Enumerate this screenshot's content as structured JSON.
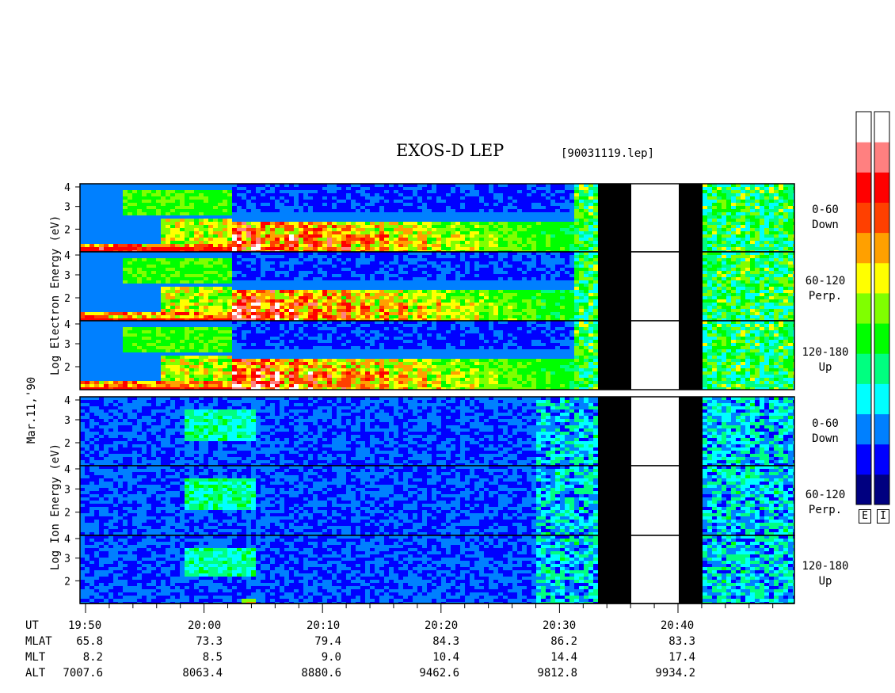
{
  "title": "EXOS-D LEP",
  "file_id": "[90031119.lep]",
  "date_label": "Mar.11,'90",
  "electron_axis_label": "Log  Electron  Energy (eV)",
  "ion_axis_label": "Log  Ion  Energy (eV)",
  "colorbar_labels": [
    "E",
    "I"
  ],
  "pitch_angle_labels": [
    {
      "range": "0-60",
      "dir": "Down"
    },
    {
      "range": "60-120",
      "dir": "Perp."
    },
    {
      "range": "120-180",
      "dir": "Up"
    },
    {
      "range": "0-60",
      "dir": "Down"
    },
    {
      "range": "60-120",
      "dir": "Perp."
    },
    {
      "range": "120-180",
      "dir": "Up"
    }
  ],
  "ephemeris": {
    "rows": [
      "UT",
      "MLAT",
      "MLT",
      "ALT"
    ],
    "columns": [
      {
        "UT": "19:50",
        "MLAT": "65.8",
        "MLT": "8.2",
        "ALT": "7007.6"
      },
      {
        "UT": "20:00",
        "MLAT": "73.3",
        "MLT": "8.5",
        "ALT": "8063.4"
      },
      {
        "UT": "20:10",
        "MLAT": "79.4",
        "MLT": "9.0",
        "ALT": "8880.6"
      },
      {
        "UT": "20:20",
        "MLAT": "84.3",
        "MLT": "10.4",
        "ALT": "9462.6"
      },
      {
        "UT": "20:30",
        "MLAT": "86.2",
        "MLT": "14.4",
        "ALT": "9812.8"
      },
      {
        "UT": "20:40",
        "MLAT": "83.3",
        "MLT": "17.4",
        "ALT": "9934.2"
      }
    ]
  },
  "chart_data": {
    "type": "heatmap",
    "title": "EXOS-D LEP",
    "xlabel": "UT",
    "x_ticks": [
      "19:50",
      "20:00",
      "20:10",
      "20:20",
      "20:30",
      "20:40"
    ],
    "x_range_minutes": [
      0,
      59
    ],
    "ylabel_electron": "Log Electron Energy (eV)",
    "ylabel_ion": "Log Ion Energy (eV)",
    "y_ticks": [
      "2",
      "3",
      "4"
    ],
    "ylim": [
      1,
      4
    ],
    "panels": [
      {
        "species": "Electron",
        "pitch_angle": "0-60",
        "direction": "Down"
      },
      {
        "species": "Electron",
        "pitch_angle": "60-120",
        "direction": "Perp."
      },
      {
        "species": "Electron",
        "pitch_angle": "120-180",
        "direction": "Up"
      },
      {
        "species": "Ion",
        "pitch_angle": "0-60",
        "direction": "Down"
      },
      {
        "species": "Ion",
        "pitch_angle": "60-120",
        "direction": "Perp."
      },
      {
        "species": "Ion",
        "pitch_angle": "120-180",
        "direction": "Up"
      }
    ],
    "colorscale": [
      "#000080",
      "#0000ff",
      "#0080ff",
      "#00ffff",
      "#00ff80",
      "#00ff00",
      "#80ff00",
      "#ffff00",
      "#ffa000",
      "#ff4000",
      "#ff0000",
      "#ff8080",
      "#ffffff"
    ]
  }
}
